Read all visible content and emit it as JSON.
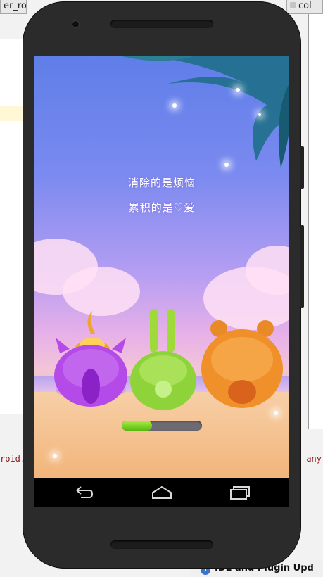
{
  "ide": {
    "tab_left_label": "er_roun",
    "tab_right_label": "col",
    "log_left": "roid.",
    "log_right": "any",
    "status_text": "IDE and Plugin Upd"
  },
  "game": {
    "slogan_line1": "消除的是烦恼",
    "slogan_line2": "累积的是♡爱",
    "loading_progress": 0.38,
    "colors": {
      "progress_fill": "#7ed321",
      "purple_creature": "#b44be8",
      "green_creature": "#8fd33a",
      "orange_creature": "#f0902a"
    }
  },
  "navbar": {
    "icons": [
      "back-icon",
      "home-icon",
      "recents-icon"
    ]
  }
}
